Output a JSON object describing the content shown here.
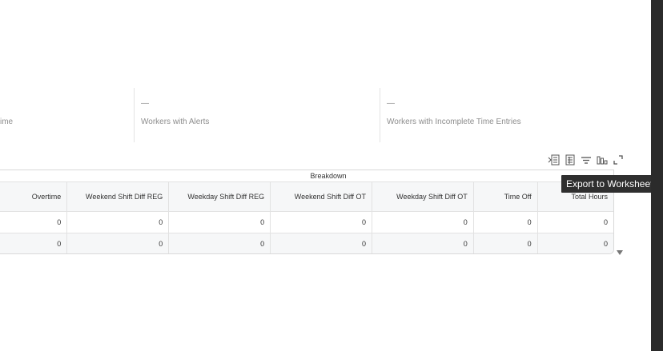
{
  "metrics": [
    {
      "value": "",
      "label": "ime"
    },
    {
      "value": "—",
      "label": "Workers with Alerts"
    },
    {
      "value": "—",
      "label": "Workers with Incomplete Time Entries"
    }
  ],
  "toolbar": {
    "icons": [
      "export-to-worksheets-icon",
      "export-to-excel-icon",
      "filter-icon",
      "chart-icon",
      "fullscreen-icon"
    ]
  },
  "tooltip": {
    "text": "Export to Worksheets"
  },
  "table": {
    "group_header": "Breakdown",
    "columns": [
      "Overtime",
      "Weekend Shift Diff REG",
      "Weekday Shift Diff REG",
      "Weekend Shift Diff OT",
      "Weekday Shift Diff OT",
      "Time Off",
      "Total Hours"
    ],
    "rows": [
      [
        "0",
        "0",
        "0",
        "0",
        "0",
        "0",
        "0"
      ],
      [
        "0",
        "0",
        "0",
        "0",
        "0",
        "0",
        "0"
      ]
    ]
  },
  "colors": {
    "tooltip_bg": "#2f2f2f",
    "header_bg": "#f6f7f8",
    "muted_text": "#8d8d8d",
    "scrollbar": "#2b2b2b"
  }
}
